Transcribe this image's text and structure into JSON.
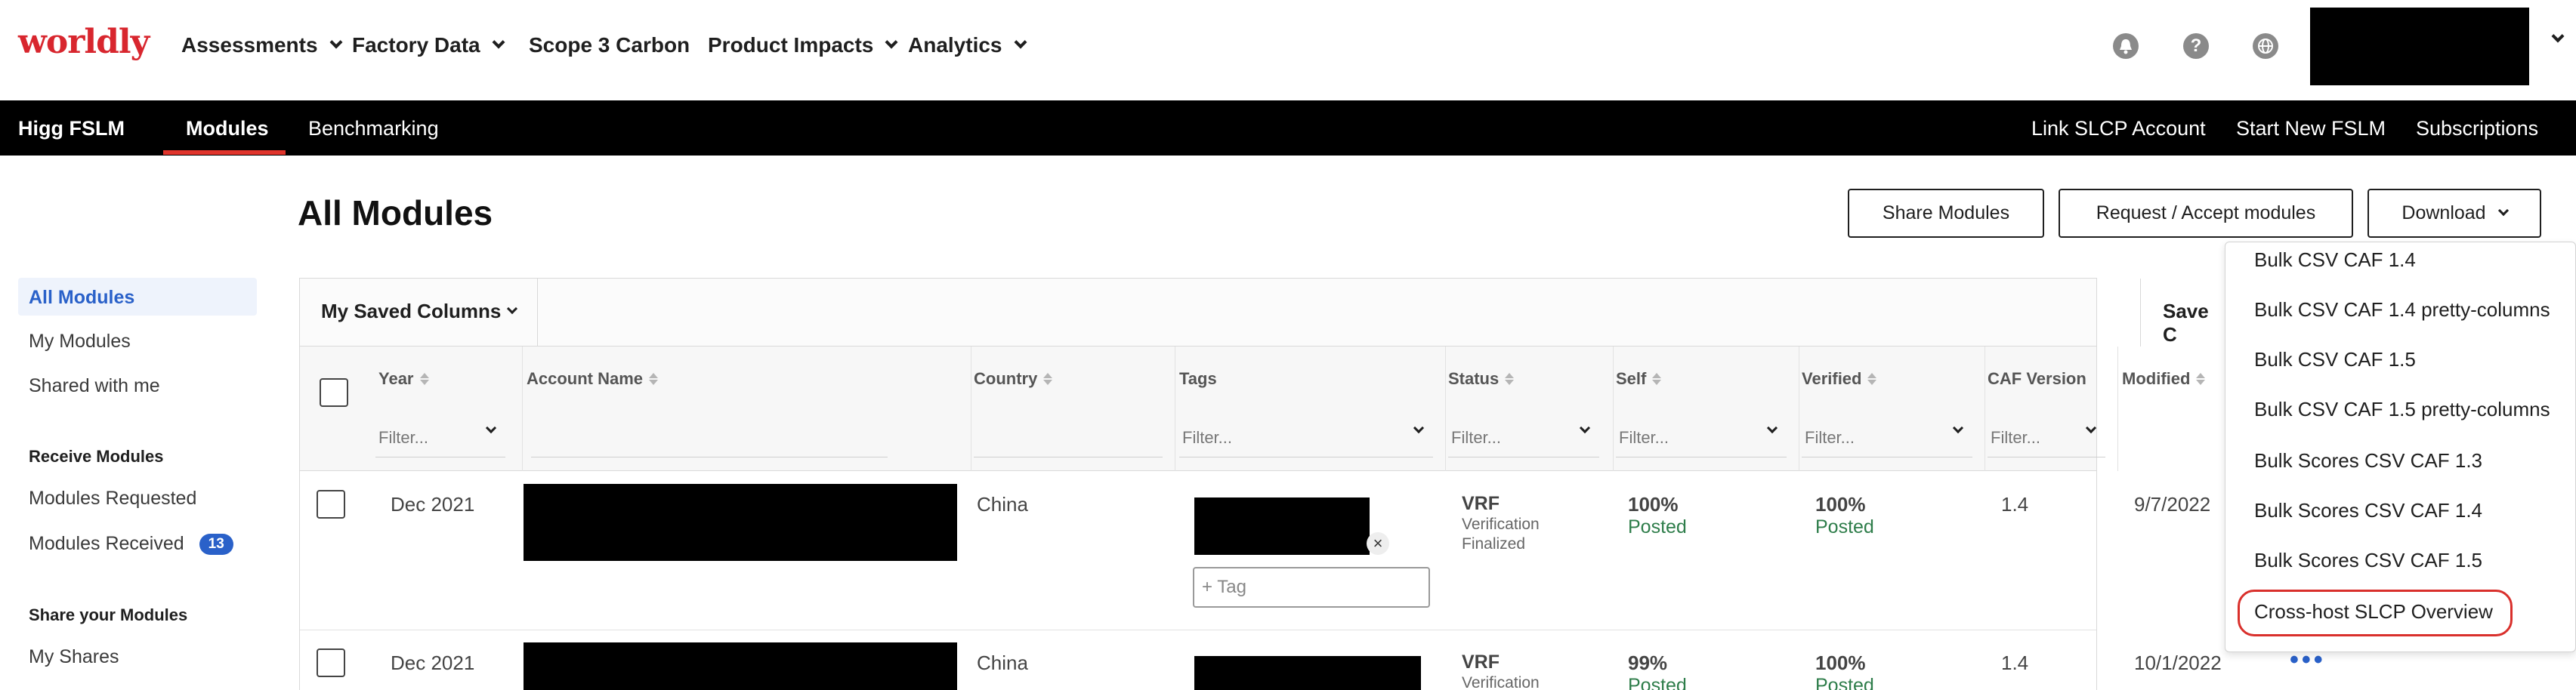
{
  "brand": {
    "logo_text": "worldly",
    "accent_color": "#d8262e"
  },
  "topnav": {
    "items": [
      {
        "label": "Assessments",
        "has_dropdown": true
      },
      {
        "label": "Factory Data",
        "has_dropdown": true
      },
      {
        "label": "Scope 3 Carbon",
        "has_dropdown": false
      },
      {
        "label": "Product Impacts",
        "has_dropdown": true
      },
      {
        "label": "Analytics",
        "has_dropdown": true
      }
    ],
    "utility_icons": [
      "bell-icon",
      "help-icon",
      "globe-icon"
    ],
    "help_glyph": "?"
  },
  "subnav": {
    "brand": "Higg FSLM",
    "tabs": [
      {
        "label": "Modules",
        "active": true
      },
      {
        "label": "Benchmarking",
        "active": false
      }
    ],
    "right_links": [
      "Link SLCP Account",
      "Start New FSLM",
      "Subscriptions"
    ]
  },
  "sidebar": {
    "items": [
      "All Modules",
      "My Modules",
      "Shared with me"
    ],
    "receive_heading": "Receive Modules",
    "receive_items": [
      "Modules Requested",
      "Modules Received"
    ],
    "modules_received_count": "13",
    "share_heading": "Share your Modules",
    "share_items": [
      "My Shares"
    ]
  },
  "main": {
    "title": "All Modules",
    "buttons": {
      "share": "Share Modules",
      "request": "Request / Accept modules",
      "download": "Download"
    }
  },
  "table": {
    "saved_columns_label": "My Saved Columns",
    "save_columns_label": "Save C",
    "columns": {
      "year": "Year",
      "account": "Account Name",
      "country": "Country",
      "tags": "Tags",
      "status": "Status",
      "self": "Self",
      "verified": "Verified",
      "caf": "CAF Version",
      "modified": "Modified"
    },
    "filter_placeholder": "Filter...",
    "tag_placeholder": "+ Tag",
    "rows": [
      {
        "year": "Dec 2021",
        "country": "China",
        "status": "VRF",
        "status_sub1": "Verification",
        "status_sub2": "Finalized",
        "self_pct": "100%",
        "self_state": "Posted",
        "verified_pct": "100%",
        "verified_state": "Posted",
        "caf": "1.4",
        "modified": "9/7/2022"
      },
      {
        "year": "Dec 2021",
        "country": "China",
        "status": "VRF",
        "status_sub1": "Verification",
        "self_pct": "99%",
        "self_state": "Posted",
        "verified_pct": "100%",
        "verified_state": "Posted",
        "caf": "1.4",
        "modified": "10/1/2022",
        "more": "•••"
      }
    ]
  },
  "download_menu": {
    "items": [
      "Bulk CSV CAF 1.4",
      "Bulk CSV CAF 1.4 pretty-columns",
      "Bulk CSV CAF 1.5",
      "Bulk CSV CAF 1.5 pretty-columns",
      "Bulk Scores CSV CAF 1.3",
      "Bulk Scores CSV CAF 1.4",
      "Bulk Scores CSV CAF 1.5",
      "Cross-host SLCP Overview"
    ],
    "highlighted_item": "Cross-host SLCP Overview",
    "highlight_color": "#d9302c"
  }
}
